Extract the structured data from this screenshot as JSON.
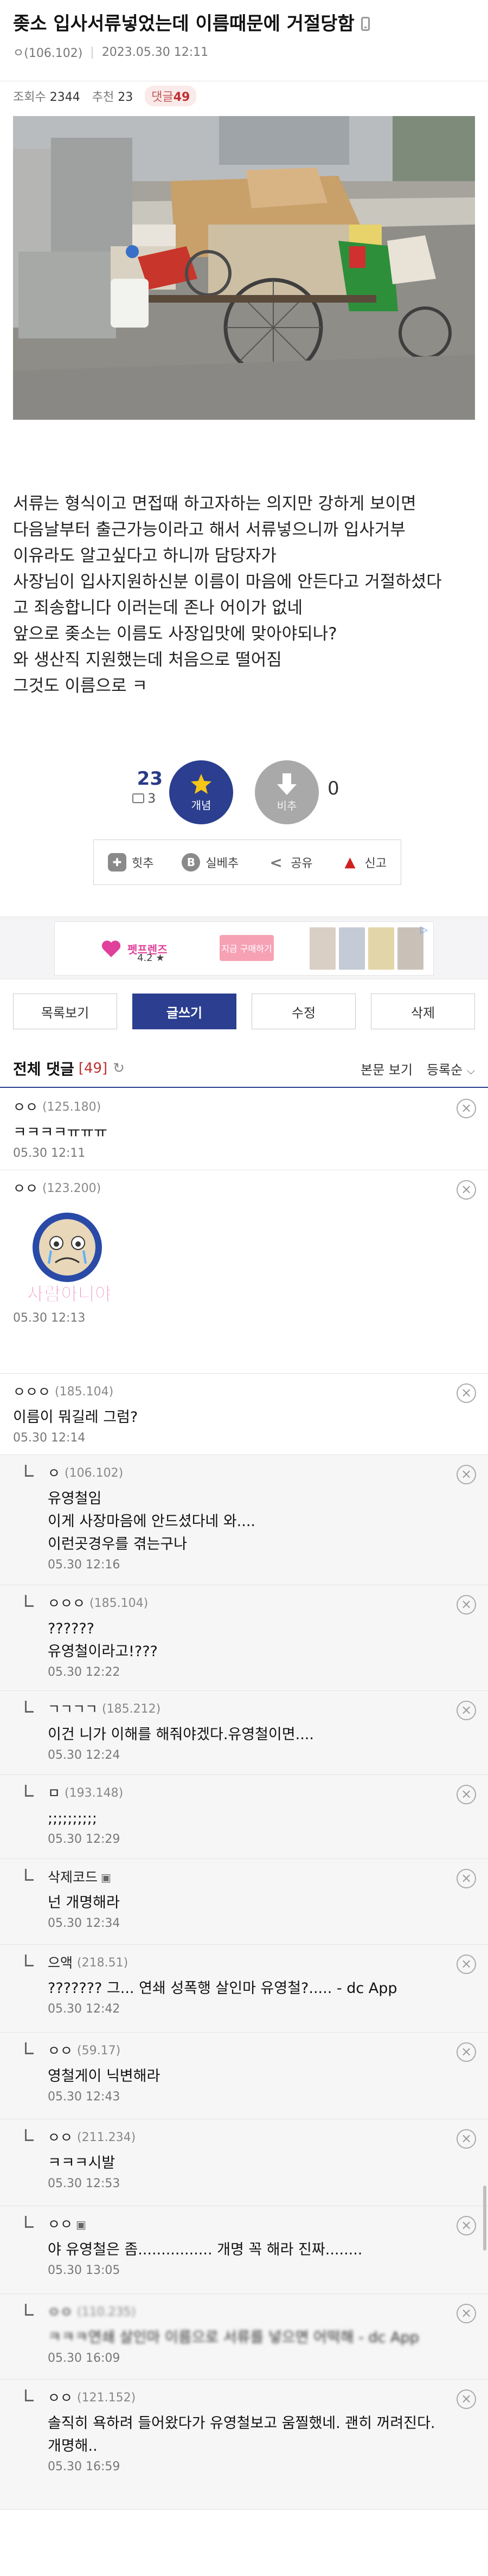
{
  "post": {
    "title": "좆소 입사서류넣었는데 이름때문에 거절당함",
    "author": "ㅇ(106.102)",
    "date": "2023.05.30 12:11",
    "views_label": "조회수",
    "views": "2344",
    "recommend_label": "추천",
    "recommend": "23",
    "comments_label": "댓글",
    "comments": "49"
  },
  "body": {
    "lines": [
      "서류는 형식이고 면접때 하고자하는 의지만 강하게 보이면",
      "다음날부터 출근가능이라고 해서 서류넣으니까 입사거부",
      "이유라도 알고싶다고 하니까 담당자가",
      "사장님이 입사지원하신분 이름이 마음에 안든다고 거절하셨다",
      "고 죄송합니다 이러는데 존나 어이가 없네",
      "앞으로 좆소는 이름도 사장입맛에 맞아야되나?",
      "와 생산직 지원했는데 처음으로 떨어짐",
      "그것도 이름으로 ㅋ"
    ]
  },
  "votes": {
    "up_count": "23",
    "fixed_count": "3",
    "up_label": "개념",
    "down_label": "비추",
    "down_count": "0"
  },
  "actions": [
    {
      "icon": "hit-icon",
      "label": "힛추"
    },
    {
      "icon": "best-icon",
      "label": "실베추"
    },
    {
      "icon": "share-icon",
      "label": "공유"
    },
    {
      "icon": "report-icon",
      "label": "신고"
    }
  ],
  "ad": {
    "brand": "펫프렌즈",
    "rating": "4.2 ★",
    "cta": "지금 구매하기"
  },
  "buttons": {
    "list": "목록보기",
    "write": "글쓰기",
    "edit": "수정",
    "delete": "삭제"
  },
  "comments_header": {
    "title": "전체 댓글",
    "count": "[49]",
    "view_original": "본문 보기",
    "sort": "등록순"
  },
  "comments": [
    {
      "nick": "ㅇㅇ",
      "ip": "(125.180)",
      "text": "ㅋㅋㅋㅋㅠㅠㅠ",
      "date": "05.30 12:11"
    },
    {
      "nick": "ㅇㅇ",
      "ip": "(123.200)",
      "text": "",
      "dccon_text": "사람아니야",
      "date": "05.30 12:13"
    },
    {
      "nick": "ㅇㅇㅇ",
      "ip": "(185.104)",
      "text": "이름이 뭐길레 그럼?",
      "date": "05.30 12:14"
    },
    {
      "nick": "ㅇ",
      "ip": "(106.102)",
      "text_lines": [
        "유영철임",
        "이게 사장마음에 안드셨다네 와....",
        "이런곳경우를 겪는구나"
      ],
      "date": "05.30 12:16"
    },
    {
      "nick": "ㅇㅇㅇ",
      "ip": "(185.104)",
      "text_lines": [
        "??????",
        "유영철이라고!???"
      ],
      "date": "05.30 12:22"
    },
    {
      "nick": "ㄱㄱㄱㄱ",
      "ip": "(185.212)",
      "text": "이건 니가 이해를 해줘야겠다.유영철이면....",
      "date": "05.30 12:24"
    },
    {
      "nick": "ㅁ",
      "ip": "(193.148)",
      "text": ";;;;;;;;;;",
      "date": "05.30 12:29"
    },
    {
      "nick": "삭제코드",
      "ip": "",
      "text": "넌 개명해라",
      "date": "05.30 12:34"
    },
    {
      "nick": "으액",
      "ip": "(218.51)",
      "text": "??????? 그... 연쇄 성폭행 살인마 유영철?..... - dc App",
      "date": "05.30 12:42"
    },
    {
      "nick": "ㅇㅇ",
      "ip": "(59.17)",
      "text": "영철게이 닉변해라",
      "date": "05.30 12:43"
    },
    {
      "nick": "ㅇㅇ",
      "ip": "(211.234)",
      "text": "ㅋㅋㅋ시발",
      "date": "05.30 12:53"
    },
    {
      "nick": "ㅇㅇ",
      "ip": "",
      "text": "야 유영철은 좀................ 개명 꼭 해라 진짜........",
      "date": "05.30 13:05"
    },
    {
      "nick": "ㅇㅇ",
      "ip": "(110.235)",
      "text": "ㅋㅋㅋ연쇄 살인마 이름으로 서류를 넣으면 어떡해 - dc App",
      "date": "05.30 16:09"
    },
    {
      "nick": "ㅇㅇ",
      "ip": "(121.152)",
      "text_lines": [
        "솔직히 욕하려 들어왔다가 유영철보고 움찔했네. 괜히 꺼려진다.",
        "개명해.."
      ],
      "date": "05.30 16:59"
    }
  ],
  "colors": {
    "brand_blue": "#2b3e8f",
    "accent_red": "#c03030"
  }
}
